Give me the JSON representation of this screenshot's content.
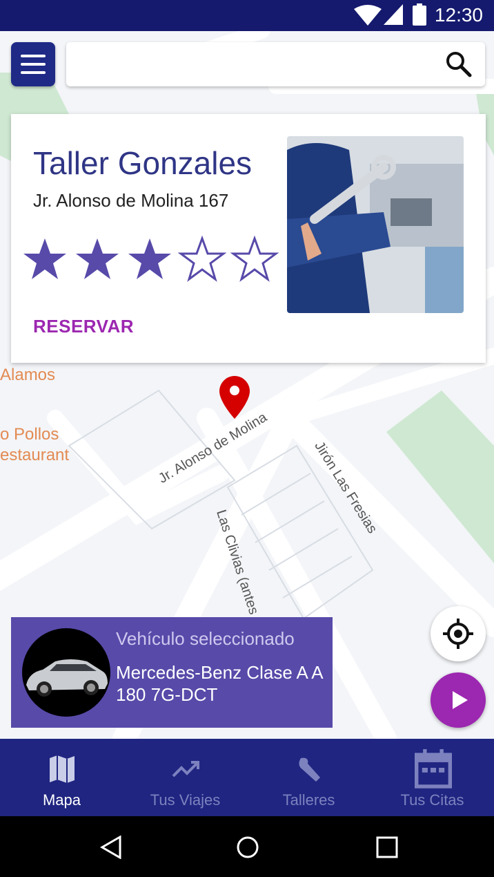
{
  "status_bar": {
    "time": "12:30"
  },
  "map": {
    "street_labels": [
      "Jr. Alonso de Molina",
      "Jirón Las Fresias",
      "Las Clivias (antes"
    ],
    "poi_labels": [
      "Alamos",
      "o Pollos",
      "estaurant"
    ]
  },
  "workshop_card": {
    "title": "Taller Gonzales",
    "address": "Jr. Alonso de Molina 167",
    "rating": 3,
    "rating_max": 5,
    "reserve_label": "RESERVAR"
  },
  "vehicle_panel": {
    "label": "Vehículo seleccionado",
    "name": "Mercedes-Benz Clase A A 180 7G-DCT"
  },
  "bottom_nav": {
    "items": [
      {
        "label": "Mapa",
        "icon": "map-icon",
        "active": true
      },
      {
        "label": "Tus Viajes",
        "icon": "trending-up-icon",
        "active": false
      },
      {
        "label": "Talleres",
        "icon": "wrench-icon",
        "active": false
      },
      {
        "label": "Tus Citas",
        "icon": "calendar-icon",
        "active": false
      }
    ]
  },
  "colors": {
    "primary": "#1f2580",
    "accent": "#9c27b0",
    "title": "#2f3585",
    "star": "#574aa9",
    "pin": "#d50000"
  }
}
